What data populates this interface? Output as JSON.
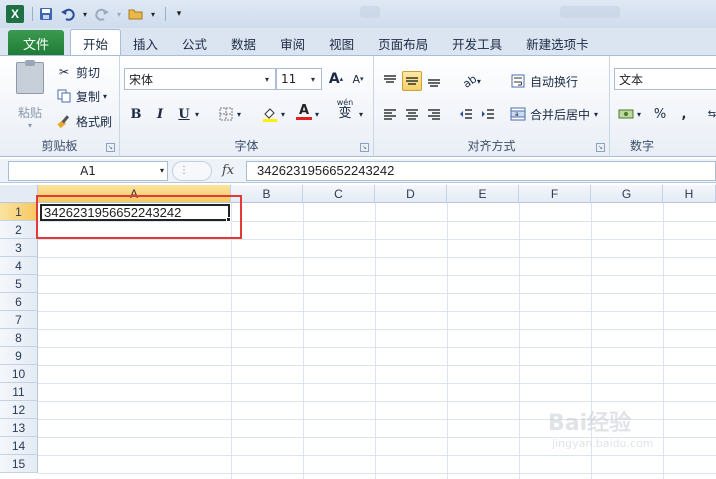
{
  "qat": {
    "icons": [
      "excel-logo",
      "save-icon",
      "undo-icon",
      "redo-icon",
      "open-folder-icon",
      "customize-icon"
    ],
    "excel_letter": "X"
  },
  "tabs": {
    "file": "文件",
    "items": [
      "开始",
      "插入",
      "公式",
      "数据",
      "审阅",
      "视图",
      "页面布局",
      "开发工具",
      "新建选项卡"
    ],
    "active": "开始"
  },
  "ribbon": {
    "clipboard": {
      "label": "剪贴板",
      "paste": "粘贴",
      "cut": "剪切",
      "copy": "复制",
      "format_painter": "格式刷"
    },
    "font": {
      "label": "字体",
      "font_name": "宋体",
      "font_size": "11",
      "bold": "B",
      "italic": "I",
      "underline": "U",
      "grow": "A",
      "shrink": "A",
      "wen": "wén",
      "wen_char": "变"
    },
    "alignment": {
      "label": "对齐方式",
      "wrap_text": "自动换行",
      "merge_center": "合并后居中"
    },
    "number": {
      "label": "数字",
      "format": "文本",
      "percent": "%",
      "comma": ","
    }
  },
  "formula_bar": {
    "name_box": "A1",
    "fx": "fx",
    "value": "3426231956652243242"
  },
  "grid": {
    "columns": [
      "A",
      "B",
      "C",
      "D",
      "E",
      "F",
      "G",
      "H"
    ],
    "rows": [
      "1",
      "2",
      "3",
      "4",
      "5",
      "6",
      "7",
      "8",
      "9",
      "10",
      "11",
      "12",
      "13",
      "14",
      "15"
    ],
    "selected_cell": "A1",
    "cell_a1": "3426231956652243242"
  },
  "colors": {
    "file_tab": "#2b8a3e",
    "selection_header": "#f6c860",
    "highlight_box": "#e53935"
  },
  "watermark": {
    "text": "Bai经验",
    "sub": "jingyan.baidu.com"
  }
}
